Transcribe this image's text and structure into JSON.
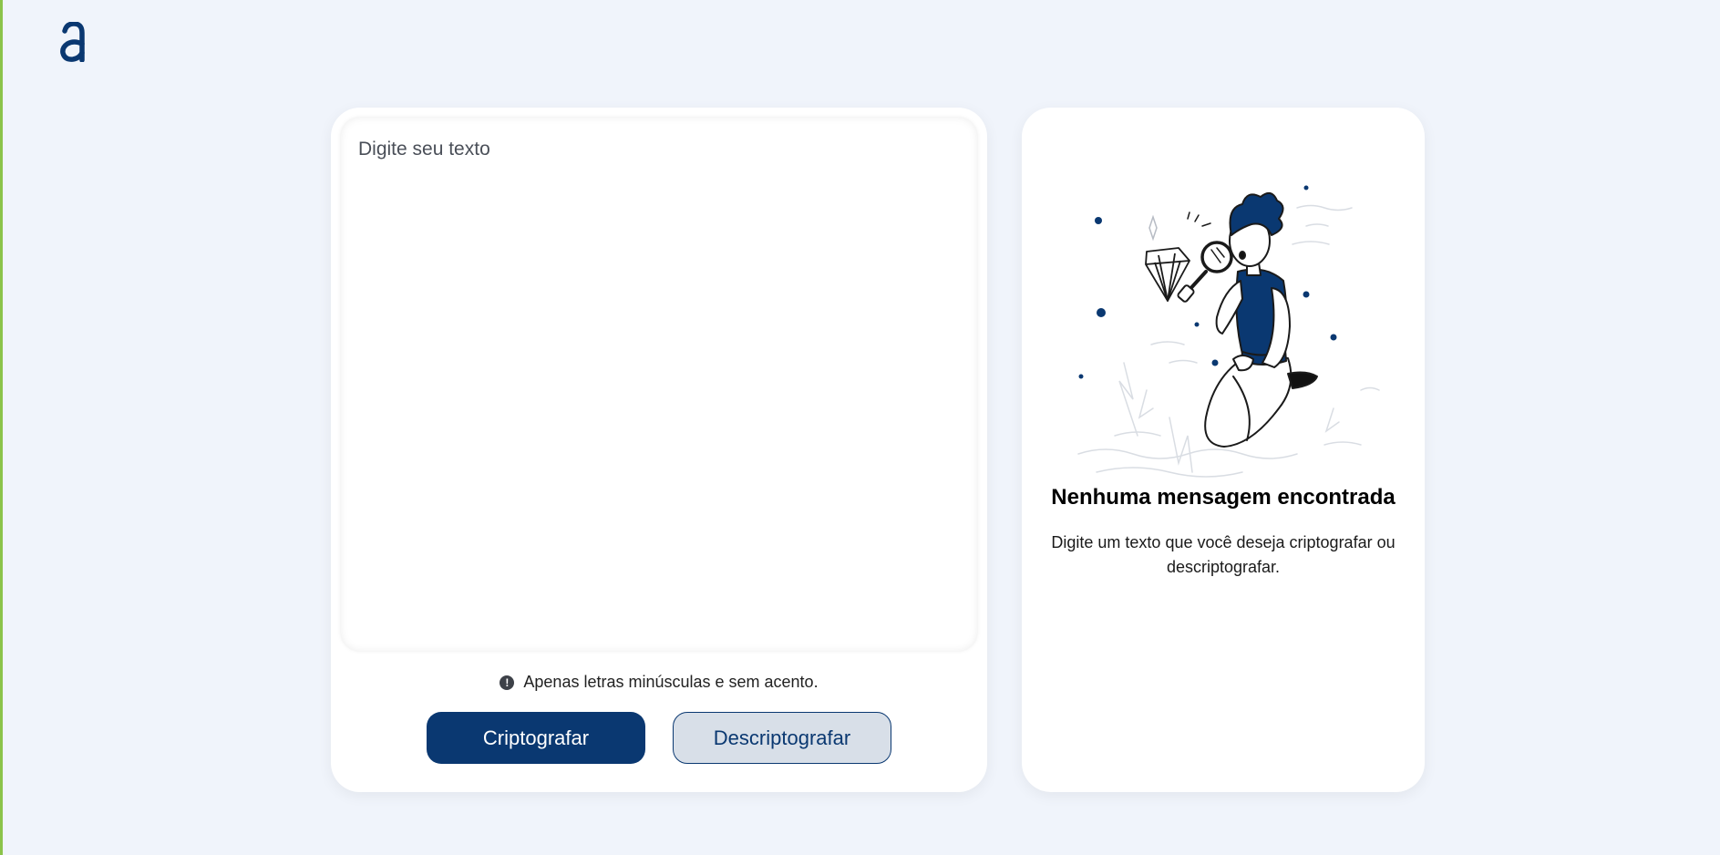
{
  "brand": {
    "logo_icon": "alura-a-logo-icon",
    "color": "#0a3871"
  },
  "input": {
    "placeholder": "Digite seu texto",
    "value": ""
  },
  "hint": {
    "icon": "exclamation-circle-icon",
    "text": "Apenas letras minúsculas e sem acento."
  },
  "buttons": {
    "encrypt_label": "Criptografar",
    "decrypt_label": "Descriptografar"
  },
  "output": {
    "illustration_icon": "person-with-magnifier-illustration",
    "title": "Nenhuma mensagem encontrada",
    "description": "Digite um texto que você deseja criptografar ou descriptografar."
  },
  "colors": {
    "background": "#f0f4fb",
    "accent": "#0a3871",
    "secondary_button_bg": "#d8dfe8",
    "left_edge": "#8bc34a"
  }
}
